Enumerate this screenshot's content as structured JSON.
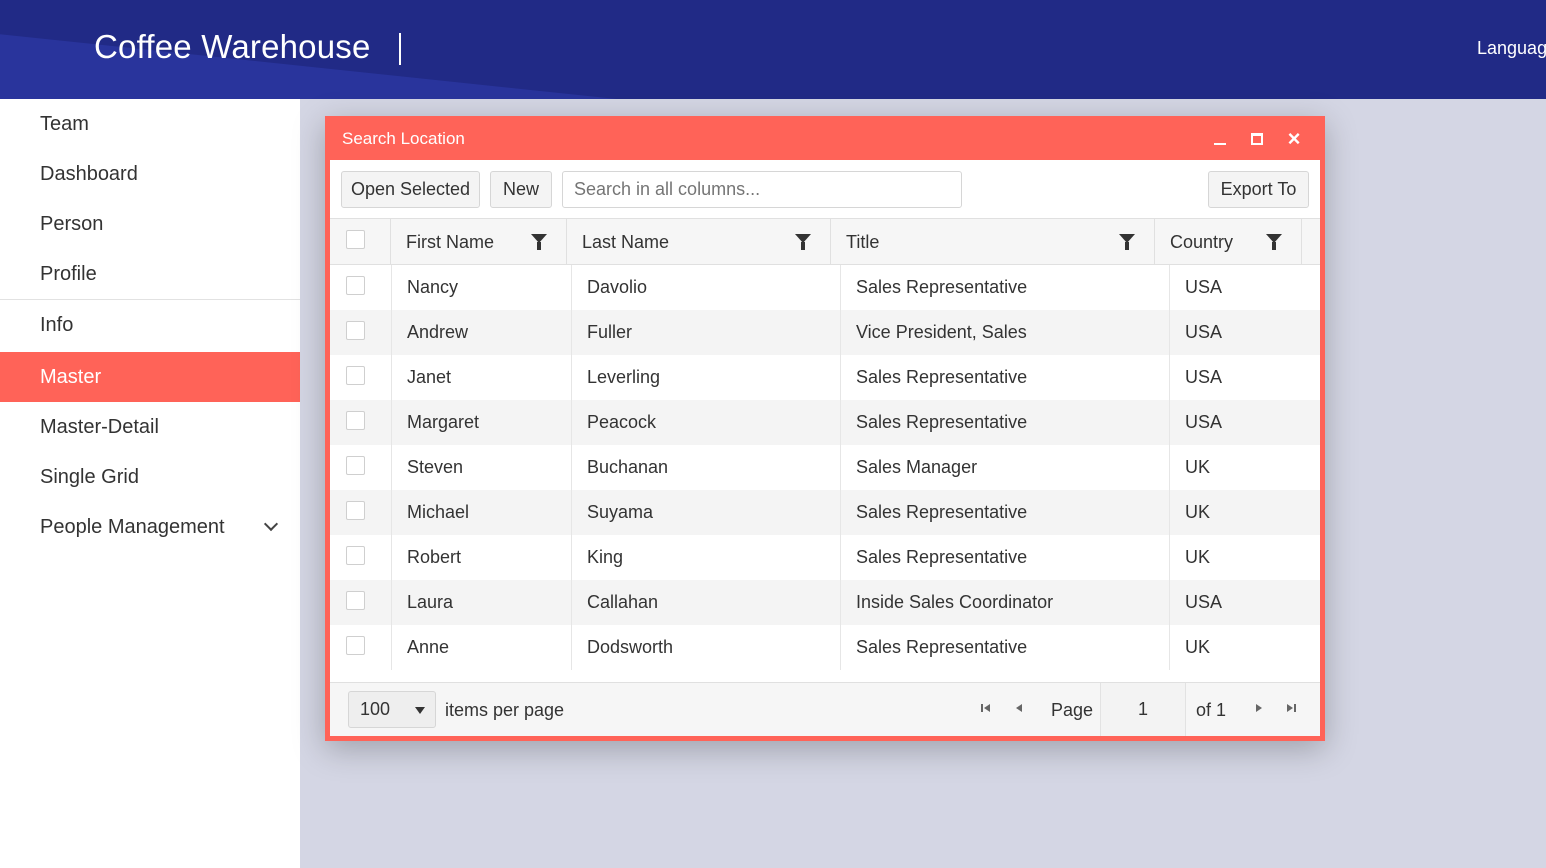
{
  "header": {
    "title": "Coffee Warehouse",
    "language": "Languag"
  },
  "sidebar": {
    "items": [
      {
        "label": "Team"
      },
      {
        "label": "Dashboard"
      },
      {
        "label": "Person"
      },
      {
        "label": "Profile"
      },
      {
        "label": "Info"
      },
      {
        "label": "Master",
        "active": true
      },
      {
        "label": "Master-Detail"
      },
      {
        "label": "Single Grid"
      },
      {
        "label": "People Management"
      }
    ]
  },
  "window": {
    "title": "Search Location",
    "toolbar": {
      "open_selected": "Open Selected",
      "new": "New",
      "search_placeholder": "Search in all columns...",
      "export": "Export To"
    },
    "columns": [
      "First Name",
      "Last Name",
      "Title",
      "Country"
    ],
    "rows": [
      {
        "first": "Nancy",
        "last": "Davolio",
        "title": "Sales Representative",
        "country": "USA"
      },
      {
        "first": "Andrew",
        "last": "Fuller",
        "title": "Vice President, Sales",
        "country": "USA"
      },
      {
        "first": "Janet",
        "last": "Leverling",
        "title": "Sales Representative",
        "country": "USA"
      },
      {
        "first": "Margaret",
        "last": "Peacock",
        "title": "Sales Representative",
        "country": "USA"
      },
      {
        "first": "Steven",
        "last": "Buchanan",
        "title": "Sales Manager",
        "country": "UK"
      },
      {
        "first": "Michael",
        "last": "Suyama",
        "title": "Sales Representative",
        "country": "UK"
      },
      {
        "first": "Robert",
        "last": "King",
        "title": "Sales Representative",
        "country": "UK"
      },
      {
        "first": "Laura",
        "last": "Callahan",
        "title": "Inside Sales Coordinator",
        "country": "USA"
      },
      {
        "first": "Anne",
        "last": "Dodsworth",
        "title": "Sales Representative",
        "country": "UK"
      }
    ],
    "pager": {
      "page_size": "100",
      "items_per_page": "items per page",
      "page_label": "Page",
      "page_value": "1",
      "of_label": "of 1"
    }
  },
  "colors": {
    "header": "#212a86",
    "accent": "#ff6358",
    "content_bg": "#d4d6e4"
  }
}
